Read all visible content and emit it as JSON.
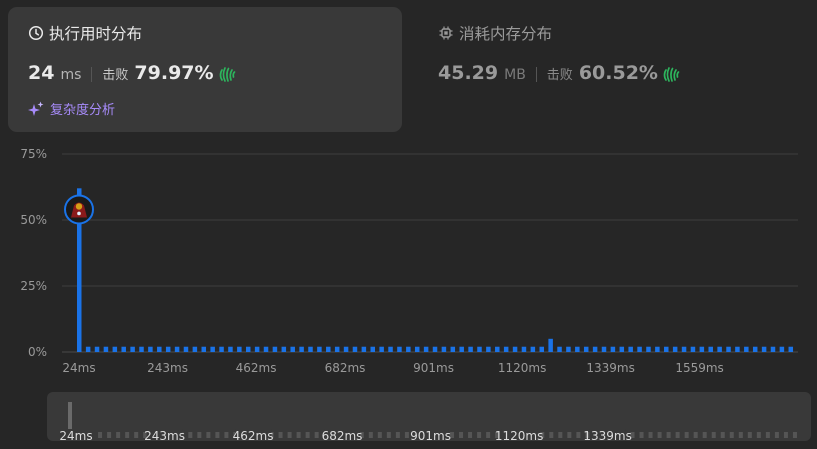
{
  "runtime_card": {
    "title": "执行用时分布",
    "value": "24",
    "unit": "ms",
    "beat_label": "击败",
    "beat_value": "79.97%",
    "complexity_link": "复杂度分析",
    "icon": "clock-icon"
  },
  "memory_card": {
    "title": "消耗内存分布",
    "value": "45.29",
    "unit": "MB",
    "beat_label": "击败",
    "beat_value": "60.52%",
    "icon": "chip-icon"
  },
  "colors": {
    "bar": "#1a73e8",
    "clap": "#2db55d",
    "accent_purple": "#a78bfa"
  },
  "chart_data": {
    "type": "bar",
    "y_ticks": [
      "75%",
      "50%",
      "25%",
      "0%"
    ],
    "ylim": [
      0,
      75
    ],
    "x_tick_labels": [
      "24ms",
      "243ms",
      "462ms",
      "682ms",
      "901ms",
      "1120ms",
      "1339ms",
      "1559ms"
    ],
    "x_tick_values": [
      24,
      243,
      462,
      682,
      901,
      1120,
      1339,
      1559
    ],
    "x_range": [
      24,
      1800
    ],
    "bin_width": 22,
    "values": [
      62,
      2,
      2,
      2,
      2,
      2,
      2,
      2,
      2,
      2,
      2,
      2,
      2,
      2,
      2,
      2,
      2,
      2,
      2,
      2,
      2,
      2,
      2,
      2,
      2,
      2,
      2,
      2,
      2,
      2,
      2,
      2,
      2,
      2,
      2,
      2,
      2,
      2,
      2,
      2,
      2,
      2,
      2,
      2,
      2,
      2,
      2,
      2,
      2,
      2,
      2,
      2,
      2,
      5,
      2,
      2,
      2,
      2,
      2,
      2,
      2,
      2,
      2,
      2,
      2,
      2,
      2,
      2,
      2,
      2,
      2,
      2,
      2,
      2,
      2,
      2,
      2,
      2,
      2,
      2,
      2
    ],
    "highlight_index": 0,
    "highlight_value": 54,
    "grid": true
  },
  "navigator": {
    "x_tick_labels": [
      "24ms",
      "243ms",
      "462ms",
      "682ms",
      "901ms",
      "1120ms",
      "1339ms"
    ]
  }
}
